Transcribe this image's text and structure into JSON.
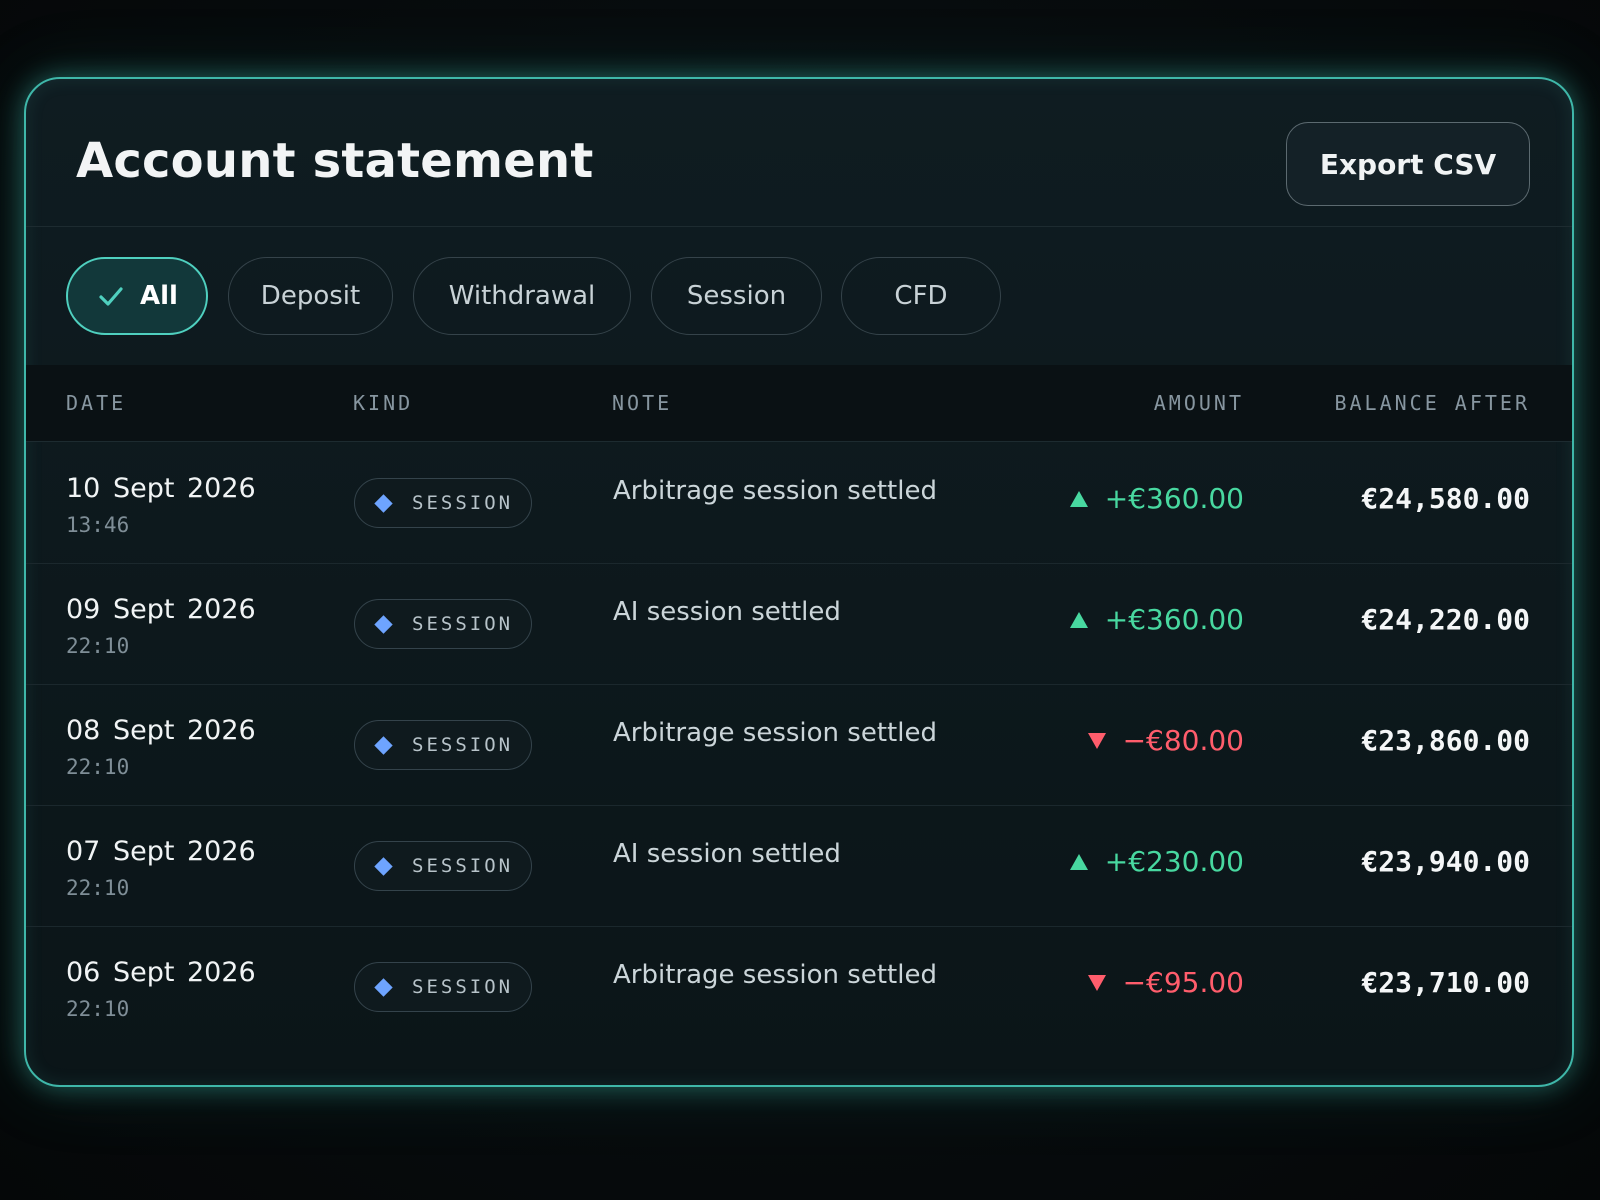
{
  "header": {
    "title": "Account statement",
    "export_label": "Export CSV"
  },
  "filters": [
    {
      "label": "All",
      "active": true
    },
    {
      "label": "Deposit",
      "active": false
    },
    {
      "label": "Withdrawal",
      "active": false
    },
    {
      "label": "Session",
      "active": false
    },
    {
      "label": "CFD",
      "active": false
    }
  ],
  "table": {
    "columns": {
      "date": "DATE",
      "kind": "KIND",
      "note": "NOTE",
      "amount": "AMOUNT",
      "balance": "BALANCE AFTER"
    },
    "rows": [
      {
        "date": "10 Sept 2026",
        "time": "13:46",
        "kind": "SESSION",
        "note": "Arbitrage session settled",
        "amount": "+€360.00",
        "direction": "up",
        "balance": "€24,580.00"
      },
      {
        "date": "09 Sept 2026",
        "time": "22:10",
        "kind": "SESSION",
        "note": "AI session settled",
        "amount": "+€360.00",
        "direction": "up",
        "balance": "€24,220.00"
      },
      {
        "date": "08 Sept 2026",
        "time": "22:10",
        "kind": "SESSION",
        "note": "Arbitrage session settled",
        "amount": "−€80.00",
        "direction": "down",
        "balance": "€23,860.00"
      },
      {
        "date": "07 Sept 2026",
        "time": "22:10",
        "kind": "SESSION",
        "note": "AI session settled",
        "amount": "+€230.00",
        "direction": "up",
        "balance": "€23,940.00"
      },
      {
        "date": "06 Sept 2026",
        "time": "22:10",
        "kind": "SESSION",
        "note": "Arbitrage session settled",
        "amount": "−€95.00",
        "direction": "down",
        "balance": "€23,710.00"
      }
    ]
  },
  "colors": {
    "accent": "#4fd0bf",
    "positive": "#48d8a0",
    "negative": "#ff5d6c",
    "kind_marker": "#6ea4ff"
  },
  "icons": {
    "filter_active": "check-icon",
    "positive": "triangle-up-icon",
    "negative": "triangle-down-icon",
    "kind": "diamond-icon"
  }
}
